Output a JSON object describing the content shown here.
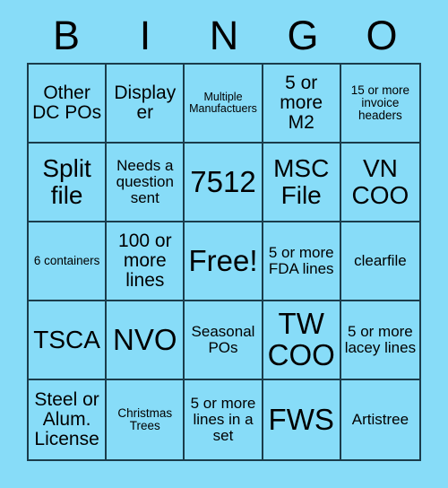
{
  "card": {
    "title": "BINGO",
    "background_color": "#87dcf8",
    "border_color": "#1b3c4b",
    "text_color": "#000000",
    "header": {
      "letters": [
        "B",
        "I",
        "N",
        "G",
        "O"
      ]
    },
    "grid": {
      "columns": 5,
      "rows": 5,
      "free_space": "Free!",
      "cells": [
        {
          "text": "Other DC POs",
          "size": "s-md"
        },
        {
          "text": "Displayer",
          "size": "s-md"
        },
        {
          "text": "Multiple Manufactuers",
          "size": "s-xxs"
        },
        {
          "text": "5 or more M2",
          "size": "s-md"
        },
        {
          "text": "15 or more invoice headers",
          "size": "s-xs"
        },
        {
          "text": "Split file",
          "size": "s-lg"
        },
        {
          "text": "Needs a question sent",
          "size": "s-sm"
        },
        {
          "text": "7512",
          "size": "s-xl"
        },
        {
          "text": "MSC File",
          "size": "s-lg"
        },
        {
          "text": "VN COO",
          "size": "s-lg"
        },
        {
          "text": "6 containers",
          "size": "s-xs"
        },
        {
          "text": "100 or more lines",
          "size": "s-md"
        },
        {
          "text": "Free!",
          "size": "s-xl"
        },
        {
          "text": "5 or more FDA lines",
          "size": "s-sm"
        },
        {
          "text": "clearfile",
          "size": "s-sm"
        },
        {
          "text": "TSCA",
          "size": "s-lg"
        },
        {
          "text": "NVO",
          "size": "s-xl"
        },
        {
          "text": "Seasonal POs",
          "size": "s-sm"
        },
        {
          "text": "TW COO",
          "size": "s-xl"
        },
        {
          "text": "5 or more lacey lines",
          "size": "s-sm"
        },
        {
          "text": "Steel or Alum. License",
          "size": "s-md"
        },
        {
          "text": "Christmas Trees",
          "size": "s-xs"
        },
        {
          "text": "5 or more lines in a set",
          "size": "s-sm"
        },
        {
          "text": "FWS",
          "size": "s-xl"
        },
        {
          "text": "Artistree",
          "size": "s-sm"
        }
      ]
    }
  }
}
